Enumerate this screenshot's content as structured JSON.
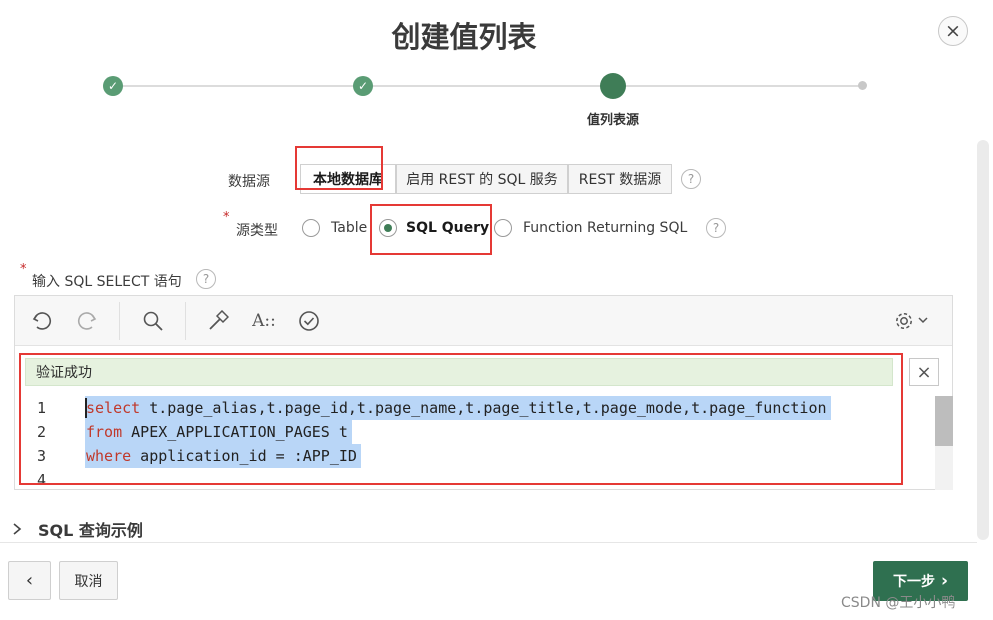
{
  "dialog": {
    "title": "创建值列表",
    "close_label": "×"
  },
  "wizard": {
    "current_step_label": "值列表源"
  },
  "data_source": {
    "label": "数据源",
    "options": [
      "本地数据库",
      "启用 REST 的 SQL 服务",
      "REST 数据源"
    ],
    "selected": "本地数据库"
  },
  "source_type": {
    "label": "源类型",
    "options": [
      "Table",
      "SQL Query",
      "Function Returning SQL"
    ],
    "selected": "SQL Query"
  },
  "sql_input": {
    "label": "输入 SQL SELECT 语句"
  },
  "editor": {
    "validation_message": "验证成功",
    "lines": [
      {
        "n": "1",
        "kw": "select",
        "rest": " t.page_alias,t.page_id,t.page_name,t.page_title,t.page_mode,t.page_function"
      },
      {
        "n": "2",
        "kw": "from",
        "rest": " APEX_APPLICATION_PAGES t"
      },
      {
        "n": "3",
        "kw": "where",
        "rest": " application_id = :APP_ID"
      },
      {
        "n": "4",
        "kw": "",
        "rest": ""
      }
    ]
  },
  "examples": {
    "label": "SQL 查询示例"
  },
  "footer": {
    "back_label": "‹",
    "cancel_label": "取消",
    "next_label": "下一步",
    "next_arrow": "›"
  },
  "watermark": "CSDN @王小小鸭",
  "colors": {
    "accent": "#3f7d57",
    "primary_button": "#2f7050",
    "highlight": "#e53935",
    "success_bg": "#e6f2df"
  }
}
